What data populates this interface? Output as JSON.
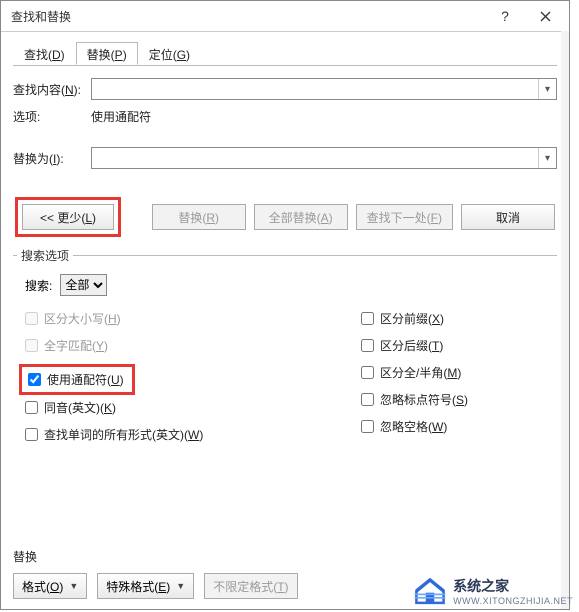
{
  "titlebar": {
    "title": "查找和替换"
  },
  "tabs": {
    "find": "查找(D)",
    "replace": "替换(P)",
    "goto": "定位(G)"
  },
  "find_label": "查找内容(N):",
  "options_label": "选项:",
  "options_value": "使用通配符",
  "replace_label": "替换为(I):",
  "buttons": {
    "more": "<< 更少(L)",
    "replace": "替换(R)",
    "replace_all": "全部替换(A)",
    "find_next": "查找下一处(F)",
    "cancel": "取消"
  },
  "search_group": "搜索选项",
  "search_label": "搜索:",
  "search_scope": "全部",
  "checks": {
    "match_case": "区分大小写(H)",
    "whole_word": "全字匹配(Y)",
    "wildcards": "使用通配符(U)",
    "sounds_like": "同音(英文)(K)",
    "all_forms": "查找单词的所有形式(英文)(W)",
    "prefix": "区分前缀(X)",
    "suffix": "区分后缀(T)",
    "full_half": "区分全/半角(M)",
    "ignore_punct": "忽略标点符号(S)",
    "ignore_space": "忽略空格(W)"
  },
  "bottom": {
    "label": "替换",
    "format": "格式(O)",
    "special": "特殊格式(E)",
    "no_format": "不限定格式(T)"
  },
  "watermark": {
    "brand": "系统之家",
    "url": "WWW.XITONGZHIJIA.NET"
  }
}
